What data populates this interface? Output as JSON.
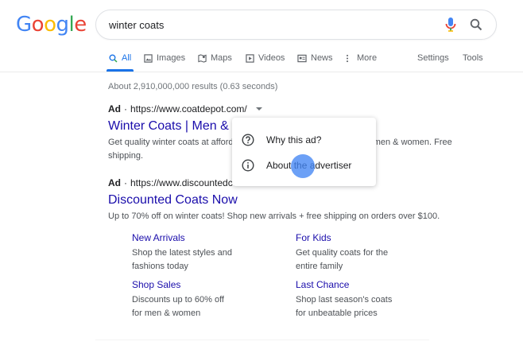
{
  "logo": {
    "letters": [
      "G",
      "o",
      "o",
      "g",
      "l",
      "e"
    ],
    "colors": [
      "#4285F4",
      "#EA4335",
      "#FBBC05",
      "#4285F4",
      "#34A853",
      "#EA4335"
    ]
  },
  "search": {
    "query": "winter coats"
  },
  "tabs": [
    {
      "label": "All",
      "icon": "search-icon"
    },
    {
      "label": "Images",
      "icon": "image-icon"
    },
    {
      "label": "Maps",
      "icon": "map-icon"
    },
    {
      "label": "Videos",
      "icon": "video-icon"
    },
    {
      "label": "News",
      "icon": "news-icon"
    },
    {
      "label": "More",
      "icon": "more-dots-icon"
    },
    {
      "label": "Settings"
    },
    {
      "label": "Tools"
    }
  ],
  "stats": "About 2,910,000,000 results (0.63 seconds)",
  "ads": [
    {
      "badge": "Ad",
      "url": "https://www.coatdepot.com/",
      "title": "Winter Coats | Men & W",
      "desc": "Get quality winter coats at afford",
      "desc_right": "r men & women. Free",
      "desc2": "shipping."
    },
    {
      "badge": "Ad",
      "url": "https://www.discountedcoatsnow.com/",
      "title": "Discounted Coats Now",
      "desc": "Up to 70% off on winter coats! Shop new arrivals + free shipping on orders over $100."
    }
  ],
  "sitelinks": [
    {
      "title": "New Arrivals",
      "desc": [
        "Shop the latest styles and",
        "fashions today"
      ]
    },
    {
      "title": "For Kids",
      "desc": [
        "Get quality coats for the",
        "entire family"
      ]
    },
    {
      "title": "Shop Sales",
      "desc": [
        "Discounts up to 60% off",
        "for men & women"
      ]
    },
    {
      "title": "Last Chance",
      "desc": [
        "Shop last season's coats",
        "for unbeatable prices"
      ]
    }
  ],
  "popup": {
    "items": [
      {
        "label": "Why this ad?",
        "icon": "question-circle-icon"
      },
      {
        "label": "About the advertiser",
        "icon": "info-circle-icon"
      }
    ]
  },
  "colors": {
    "link": "#1a0dab",
    "accent": "#1a73e8",
    "touch": "#4285F4"
  }
}
